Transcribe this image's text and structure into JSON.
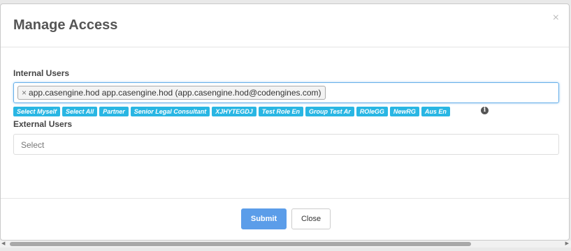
{
  "dialog": {
    "title": "Manage Access",
    "close_glyph": "×"
  },
  "internal_users": {
    "label": "Internal Users",
    "selected": [
      {
        "remove_glyph": "×",
        "text": "app.casengine.hod app.casengine.hod (app.casengine.hod@codengines.com)"
      }
    ],
    "quick_select": [
      "Select Myself",
      "Select All",
      "Partner",
      "Senior Legal Consultant",
      "XJHYTEGDJ",
      "Test Role En",
      "Group Test Ar",
      "ROleGG",
      "NewRG",
      "Aus En"
    ],
    "info_icon": "info-icon"
  },
  "external_users": {
    "label": "External Users",
    "placeholder": "Select"
  },
  "footer": {
    "submit_label": "Submit",
    "close_label": "Close"
  },
  "colors": {
    "chip_bg": "#29b6e3",
    "submit_bg": "#5b9de9",
    "focus_border": "#66afe9"
  },
  "scrollbar": {
    "left_arrow": "◀",
    "right_arrow": "▶"
  }
}
